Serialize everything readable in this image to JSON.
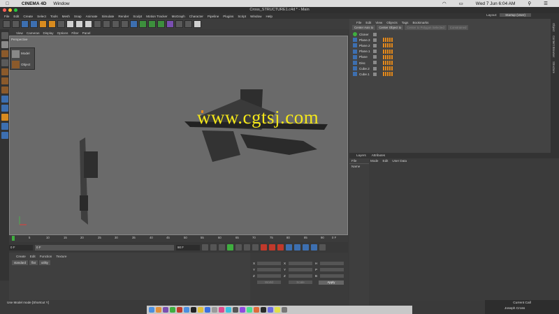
{
  "mac": {
    "apple": "",
    "app": "CINEMA 4D",
    "window": "Window",
    "datetime": "Wed 7 Jun  6:04 AM"
  },
  "title": "Cross_STRUCTURE1.c4d * - Main",
  "menubar": [
    "File",
    "Edit",
    "Create",
    "Select",
    "Tools",
    "Mesh",
    "Snap",
    "Animate",
    "Simulate",
    "Render",
    "Sculpt",
    "Motion Tracker",
    "MoGraph",
    "Character",
    "Pipeline",
    "Plugins",
    "Script",
    "Window",
    "Help"
  ],
  "layout": {
    "label": "Layout:",
    "value": "Startup (User)"
  },
  "viewport": {
    "menu": [
      "View",
      "Cameras",
      "Display",
      "Options",
      "Filter",
      "Panel"
    ],
    "label": "Perspective",
    "watermark": "www.cgtsj.com"
  },
  "popup": {
    "items": [
      "Model",
      "Object"
    ]
  },
  "timeline": {
    "ticks": [
      "0",
      "5",
      "10",
      "15",
      "20",
      "25",
      "30",
      "35",
      "40",
      "45",
      "50",
      "55",
      "60",
      "65",
      "70",
      "75",
      "80",
      "85",
      "90"
    ],
    "end_label": "0 F"
  },
  "playbar": {
    "current": "0 F",
    "start": "0 F",
    "end": "90 F",
    "end2": "90 F"
  },
  "material": {
    "menu": [
      "Create",
      "Edit",
      "Function",
      "Texture"
    ],
    "tabs": [
      "standard",
      "flat",
      "utility"
    ]
  },
  "coords": {
    "rows": [
      {
        "a": "X",
        "b": "X",
        "c": "H"
      },
      {
        "a": "Y",
        "b": "Y",
        "c": "P"
      },
      {
        "a": "Z",
        "b": "Z",
        "c": "B"
      }
    ],
    "dd1": "World",
    "dd2": "Scale",
    "apply": "Apply"
  },
  "status": "Use Model mode [Shortcut Y]",
  "objects": {
    "menu": [
      "File",
      "Edit",
      "View",
      "Objects",
      "Tags",
      "Bookmarks"
    ],
    "tabs": [
      "Center Axis to",
      "Center Object to",
      "Center to Polygon Selected",
      "Constrained"
    ],
    "items": [
      "Cloner",
      "Plane.3",
      "Plane.2",
      "Plane.1",
      "Plane",
      "Disc",
      "Cube.2",
      "Cube.1"
    ]
  },
  "side_tabs": [
    "Object",
    "Content Browser",
    "Structure"
  ],
  "attributes": {
    "tabs": [
      "Layers",
      "Attributes"
    ],
    "layers_menu": [
      "File"
    ],
    "layers_header": "Name",
    "menu": [
      "Mode",
      "Edit",
      "User Data"
    ]
  },
  "call": {
    "title": "Current Call",
    "name": "Joseph Cross"
  },
  "colors": {
    "accent": "#f5e81a",
    "tag_orange": "#e58a1c",
    "viewport_bg": "#6a6a6a"
  }
}
